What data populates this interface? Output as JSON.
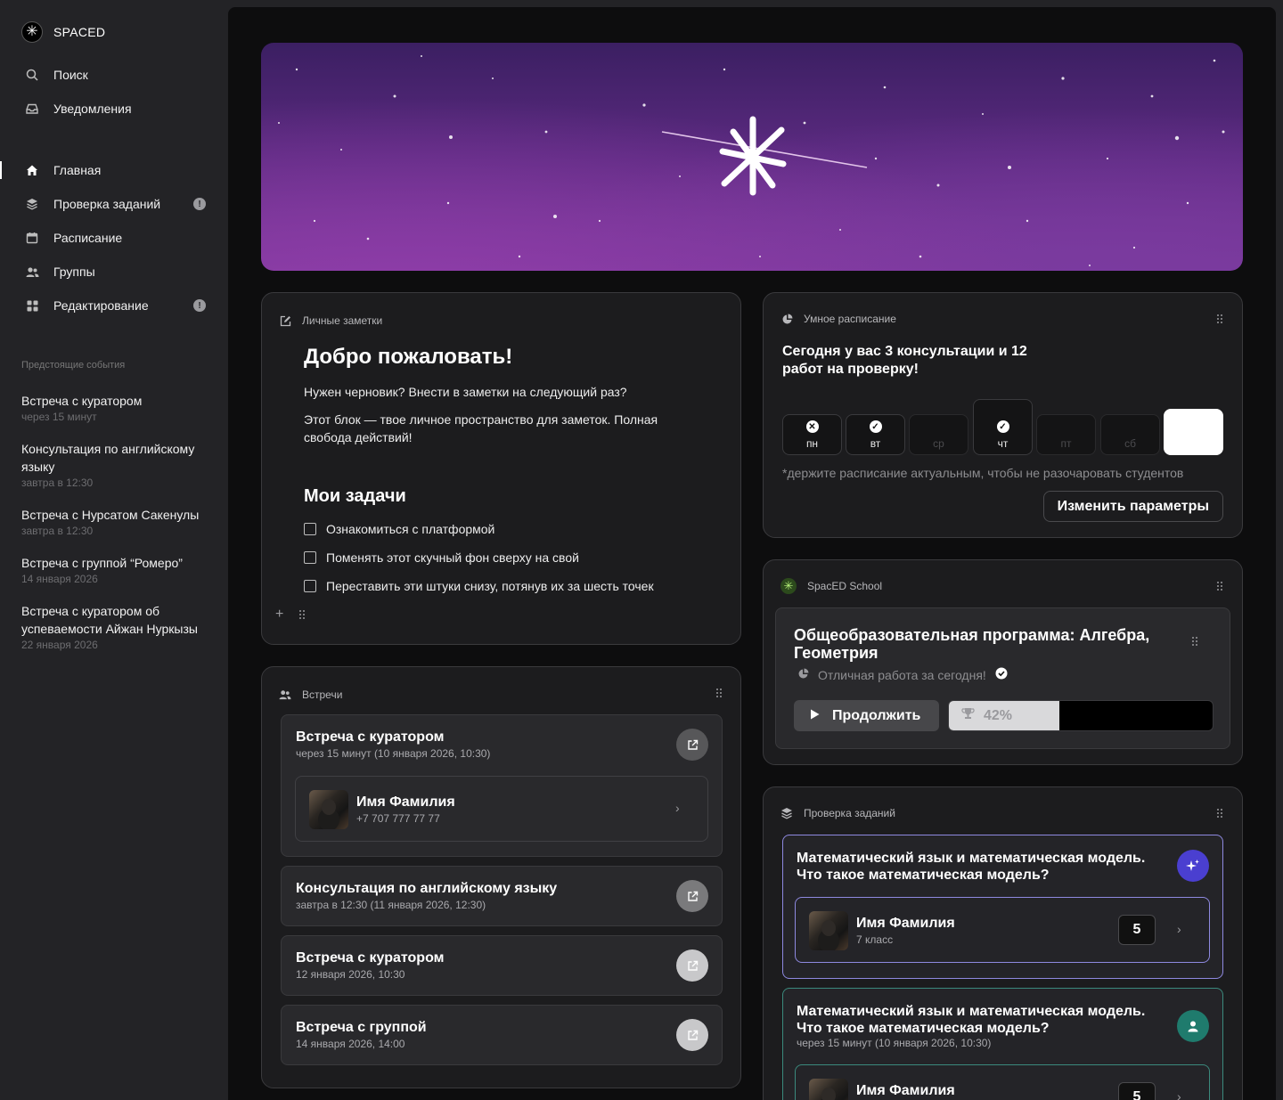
{
  "brand": {
    "name": "SPACED",
    "logo_icon": "asterisk"
  },
  "sidebar": {
    "top_items": [
      {
        "label": "Поиск",
        "icon": "search-icon"
      },
      {
        "label": "Уведомления",
        "icon": "inbox-icon"
      }
    ],
    "items": [
      {
        "label": "Главная",
        "icon": "home-icon",
        "active": true
      },
      {
        "label": "Проверка заданий",
        "icon": "layers-icon",
        "badge": "!"
      },
      {
        "label": "Расписание",
        "icon": "calendar-icon"
      },
      {
        "label": "Группы",
        "icon": "users-icon"
      },
      {
        "label": "Редактирование",
        "icon": "grid-icon",
        "badge": "!"
      }
    ],
    "events_title": "Предстоящие события",
    "events": [
      {
        "title": "Встреча с куратором",
        "date": "через 15 минут"
      },
      {
        "title": "Консультация по английскому языку",
        "date": "завтра в 12:30"
      },
      {
        "title": "Встреча с Нурсатом Сакенулы",
        "date": "завтра в 12:30"
      },
      {
        "title": "Встреча с группой “Ромеро”",
        "date": "14 января 2026"
      },
      {
        "title": "Встреча с куратором об успеваемости Айжан Нуркызы",
        "date": "22 января 2026"
      }
    ]
  },
  "notes": {
    "header": "Личные заметки",
    "title": "Добро пожаловать!",
    "p1": "Нужен черновик? Внести в заметки на следующий раз?",
    "p2": "Этот блок — твое личное пространство для заметок. Полная свобода действий!",
    "tasks_title": "Мои задачи",
    "tasks": [
      "Ознакомиться с платформой",
      "Поменять этот скучный фон сверху на свой",
      "Переставить эти штуки снизу, потянув их за шесть точек"
    ],
    "add_label": "+"
  },
  "meetings": {
    "header": "Встречи",
    "items": [
      {
        "title": "Встреча с куратором",
        "subtitle": "через 15 минут (10 января 2026, 10:30)"
      },
      {
        "title": "Консультация по английскому языку",
        "subtitle": "завтра в 12:30 (11 января 2026, 12:30)"
      },
      {
        "title": "Встреча с куратором",
        "subtitle": "12 января 2026, 10:30"
      },
      {
        "title": "Встреча с группой",
        "subtitle": "14 января 2026, 14:00"
      }
    ],
    "person": {
      "name": "Имя Фамилия",
      "phone": "+7 707 777 77 77"
    }
  },
  "schedule": {
    "header": "Умное расписание",
    "title": "Сегодня у вас 3 консультации и 12 работ на проверку!",
    "days": [
      {
        "label": "пн",
        "mark": "✕"
      },
      {
        "label": "вт",
        "mark": "✓"
      },
      {
        "label": "ср",
        "mark": ""
      },
      {
        "label": "чт",
        "mark": "✓"
      },
      {
        "label": "пт",
        "mark": ""
      },
      {
        "label": "сб",
        "mark": ""
      },
      {
        "label": "",
        "mark": ""
      }
    ],
    "note": "*держите расписание актуальным, чтобы не разочаровать студентов",
    "button": "Изменить параметры"
  },
  "school": {
    "header": "SpacED School",
    "course_title": "Общеобразовательная программа: Алгебра, Геометрия",
    "status": "Отличная работа за сегодня!",
    "continue": "Продолжить",
    "progress_label": "42%",
    "progress": 0.42
  },
  "review": {
    "header": "Проверка заданий",
    "items": [
      {
        "title": "Математический язык и математическая модель. Что такое математическая модель?",
        "subtitle": "",
        "person": "Имя Фамилия",
        "grade": "7 класс",
        "score": "5"
      },
      {
        "title": "Математический язык и математическая модель. Что такое математическая модель?",
        "subtitle": "через 15 минут (10 января 2026, 10:30)",
        "person": "Имя Фамилия",
        "grade": "",
        "score": "5"
      }
    ]
  },
  "colors": {
    "accent_purple": "#4a3fd0",
    "accent_teal": "#1f7b6d",
    "bg": "#0d0d0e",
    "sidebar": "#232326"
  }
}
